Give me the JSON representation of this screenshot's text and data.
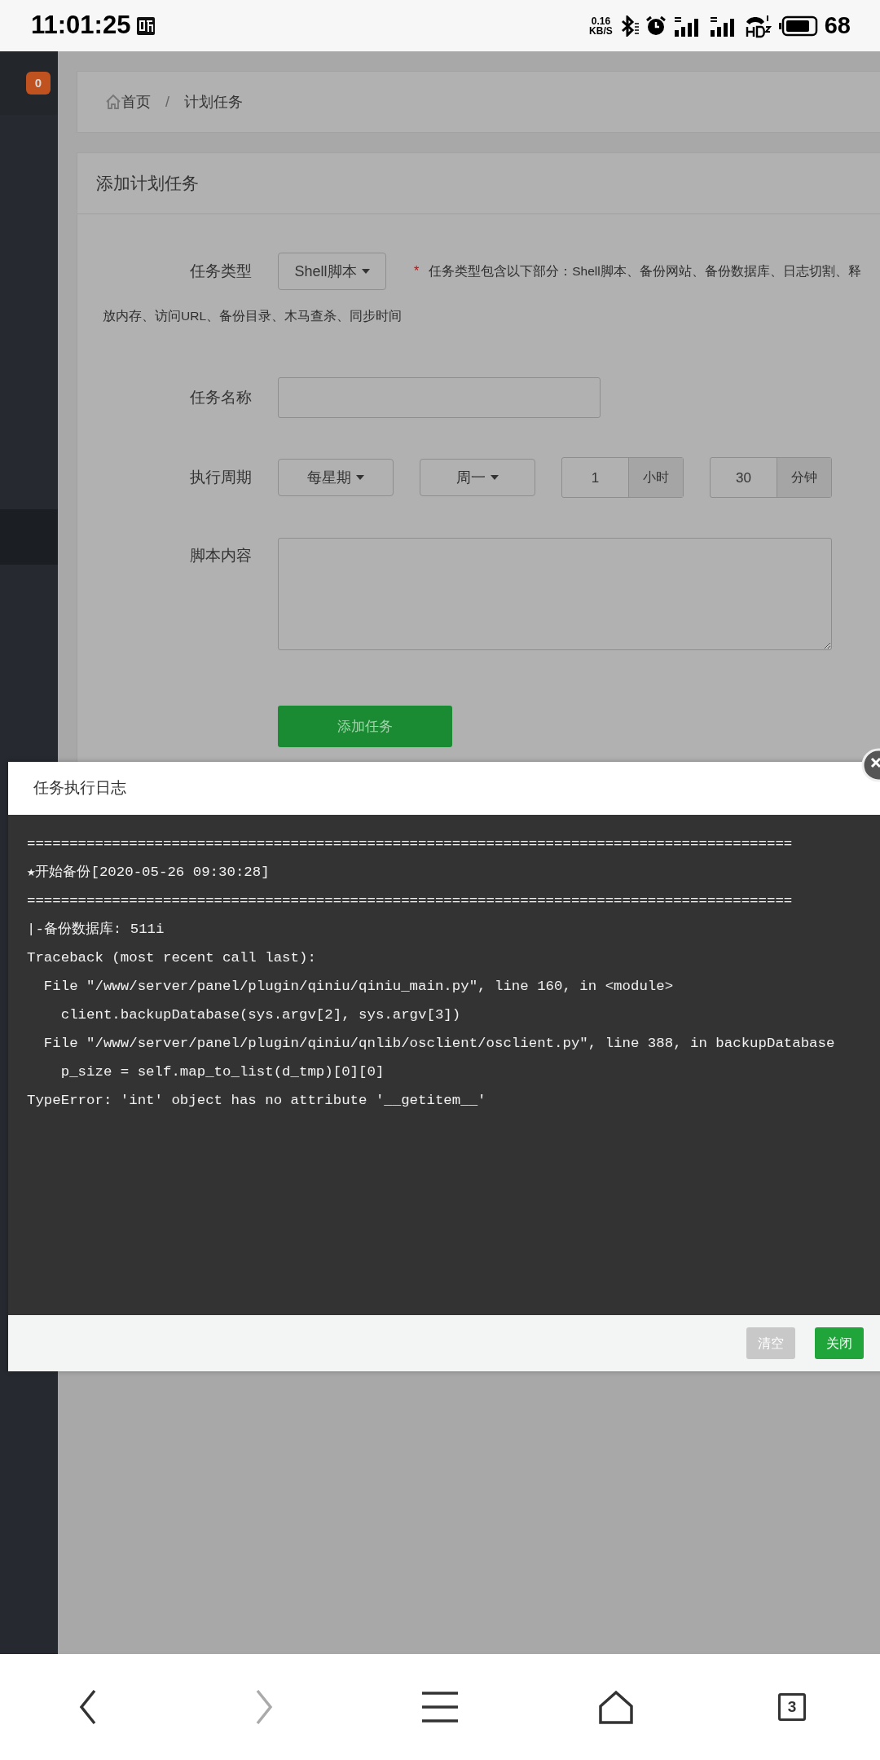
{
  "status_bar": {
    "time": "11:01:25",
    "net_speed": [
      "0.16",
      "KB/S"
    ],
    "battery": "68"
  },
  "sidebar": {
    "badge": "0"
  },
  "breadcrumb": {
    "items": [
      "首页",
      "计划任务"
    ],
    "separator": "/"
  },
  "form": {
    "title": "添加计划任务",
    "rows": [
      {
        "kind": "select",
        "label": "任务类型",
        "value": "Shell脚本",
        "required_mark": "*",
        "note": "任务类型包含以下部分：Shell脚本、备份网站、备份数据库、日志切割、释",
        "note_continued": "放内存、访问URL、备份目录、木马查杀、同步时间"
      },
      {
        "kind": "text",
        "label": "任务名称"
      },
      {
        "kind": "period",
        "label": "执行周期",
        "selects": [
          "每星期",
          "周一"
        ],
        "inputs": [
          {
            "value": "1",
            "unit": "小时"
          },
          {
            "value": "30",
            "unit": "分钟"
          }
        ]
      },
      {
        "kind": "textarea",
        "label": "脚本内容"
      }
    ],
    "submit": "添加任务"
  },
  "modal": {
    "title": "任务执行日志",
    "log": [
      "==========================================================================================",
      "★开始备份[2020-05-26 09:30:28]",
      "==========================================================================================",
      "|-备份数据库: 511i",
      "Traceback (most recent call last):",
      "  File \"/www/server/panel/plugin/qiniu/qiniu_main.py\", line 160, in <module>",
      "    client.backupDatabase(sys.argv[2], sys.argv[3])",
      "  File \"/www/server/panel/plugin/qiniu/qnlib/osclient/osclient.py\", line 388, in backupDatabase",
      "    p_size = self.map_to_list(d_tmp)[0][0]",
      "TypeError: 'int' object has no attribute '__getitem__'"
    ],
    "buttons": [
      {
        "label": "清空",
        "kind": "secondary"
      },
      {
        "label": "关闭",
        "kind": "primary"
      }
    ]
  },
  "nav_bar": {
    "buttons": [
      {
        "kind": "back",
        "disabled": false
      },
      {
        "kind": "forward",
        "disabled": true
      },
      {
        "kind": "menu",
        "disabled": false
      },
      {
        "kind": "home",
        "disabled": false
      },
      {
        "kind": "tabs",
        "disabled": false,
        "count": "3"
      }
    ]
  }
}
